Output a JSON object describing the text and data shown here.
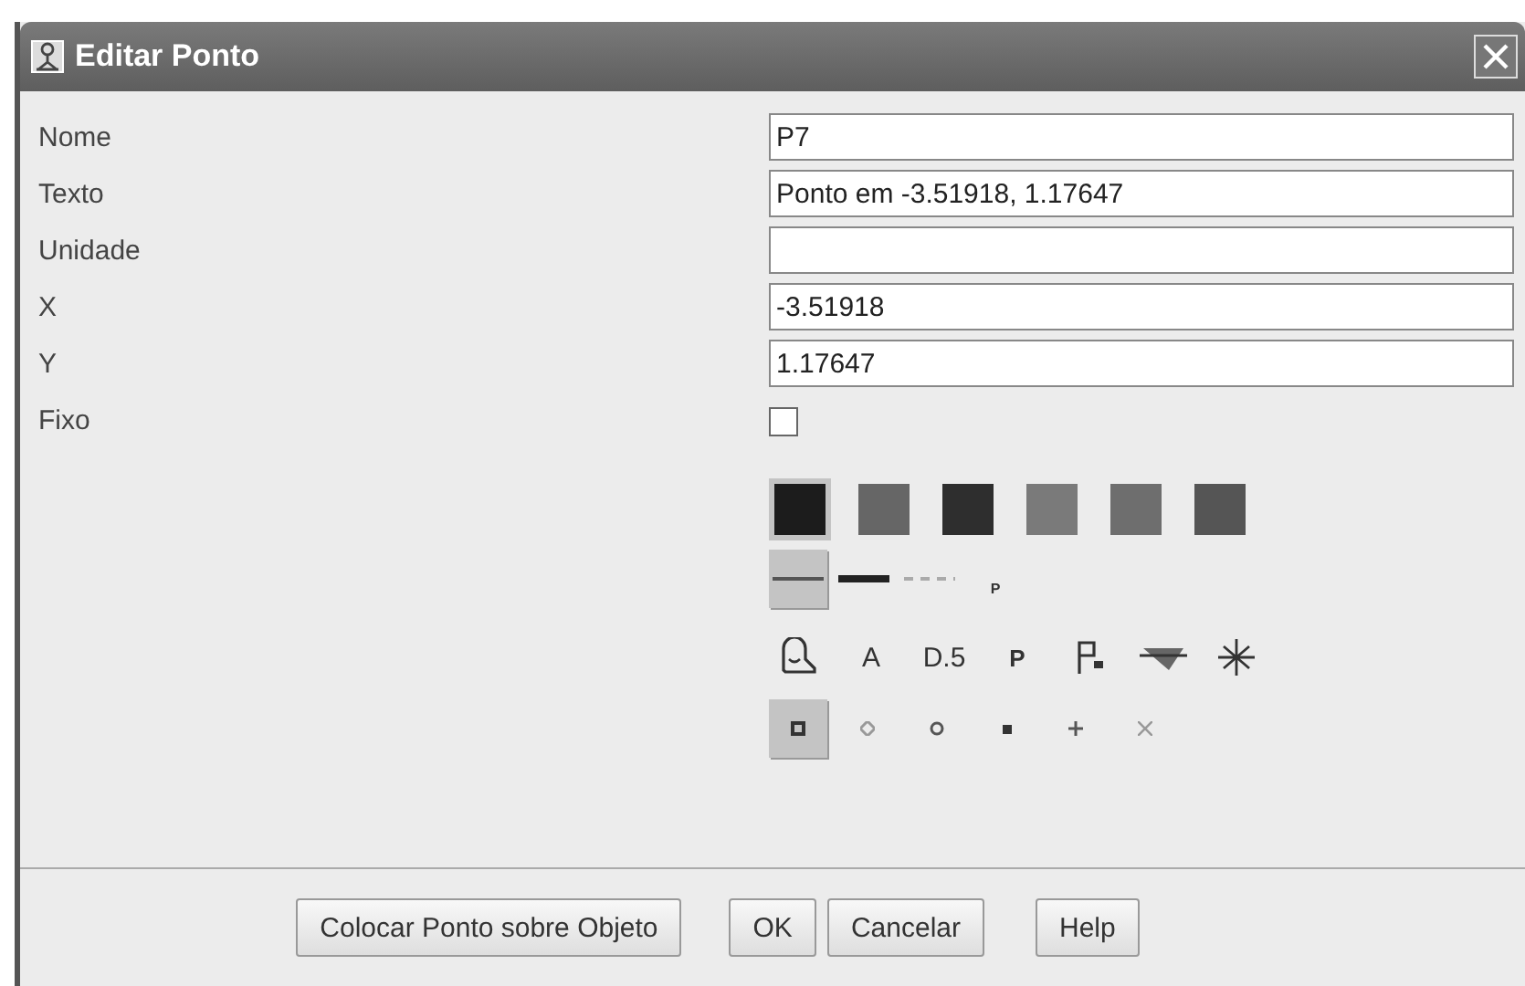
{
  "window": {
    "title": "Editar Ponto"
  },
  "fields": [
    {
      "kind": "text",
      "label": "Nome",
      "value": "P7"
    },
    {
      "kind": "text",
      "label": "Texto",
      "value": "Ponto em -3.51918, 1.17647"
    },
    {
      "kind": "text",
      "label": "Unidade"
    },
    {
      "kind": "text",
      "label": "X",
      "value": "-3.51918"
    },
    {
      "kind": "text",
      "label": "Y",
      "value": "1.17647"
    },
    {
      "kind": "checkbox",
      "label": "Fixo",
      "checked": false
    }
  ],
  "colors": [
    {
      "color": "#1c1c1c",
      "selected": true
    },
    {
      "color": "#666666",
      "selected": false
    },
    {
      "color": "#2e2e2e",
      "selected": false
    },
    {
      "color": "#7a7a7a",
      "selected": false
    },
    {
      "color": "#6e6e6e",
      "selected": false
    },
    {
      "color": "#555555",
      "selected": false
    }
  ],
  "line_styles": [
    {
      "kind": "thin",
      "selected": true
    },
    {
      "kind": "thick",
      "selected": false
    },
    {
      "kind": "dashed",
      "selected": false
    },
    {
      "kind": "label",
      "text": "P",
      "selected": false
    }
  ],
  "label_styles": [
    {
      "kind": "icon-magnifier",
      "selected": false
    },
    {
      "kind": "text",
      "text": "A",
      "selected": false
    },
    {
      "kind": "text",
      "text": "D.5",
      "selected": false
    },
    {
      "kind": "bold",
      "text": "P",
      "selected": false
    },
    {
      "kind": "icon-flag",
      "selected": false
    },
    {
      "kind": "icon-fill",
      "selected": false
    },
    {
      "kind": "icon-star",
      "selected": false
    }
  ],
  "point_styles": [
    {
      "kind": "square",
      "selected": true
    },
    {
      "kind": "diamond",
      "selected": false
    },
    {
      "kind": "circle",
      "selected": false
    },
    {
      "kind": "dot",
      "selected": false
    },
    {
      "kind": "plus",
      "selected": false
    },
    {
      "kind": "cross",
      "selected": false
    }
  ],
  "buttons": [
    "Colocar Ponto sobre Objeto",
    "OK",
    "Cancelar",
    "Help"
  ]
}
